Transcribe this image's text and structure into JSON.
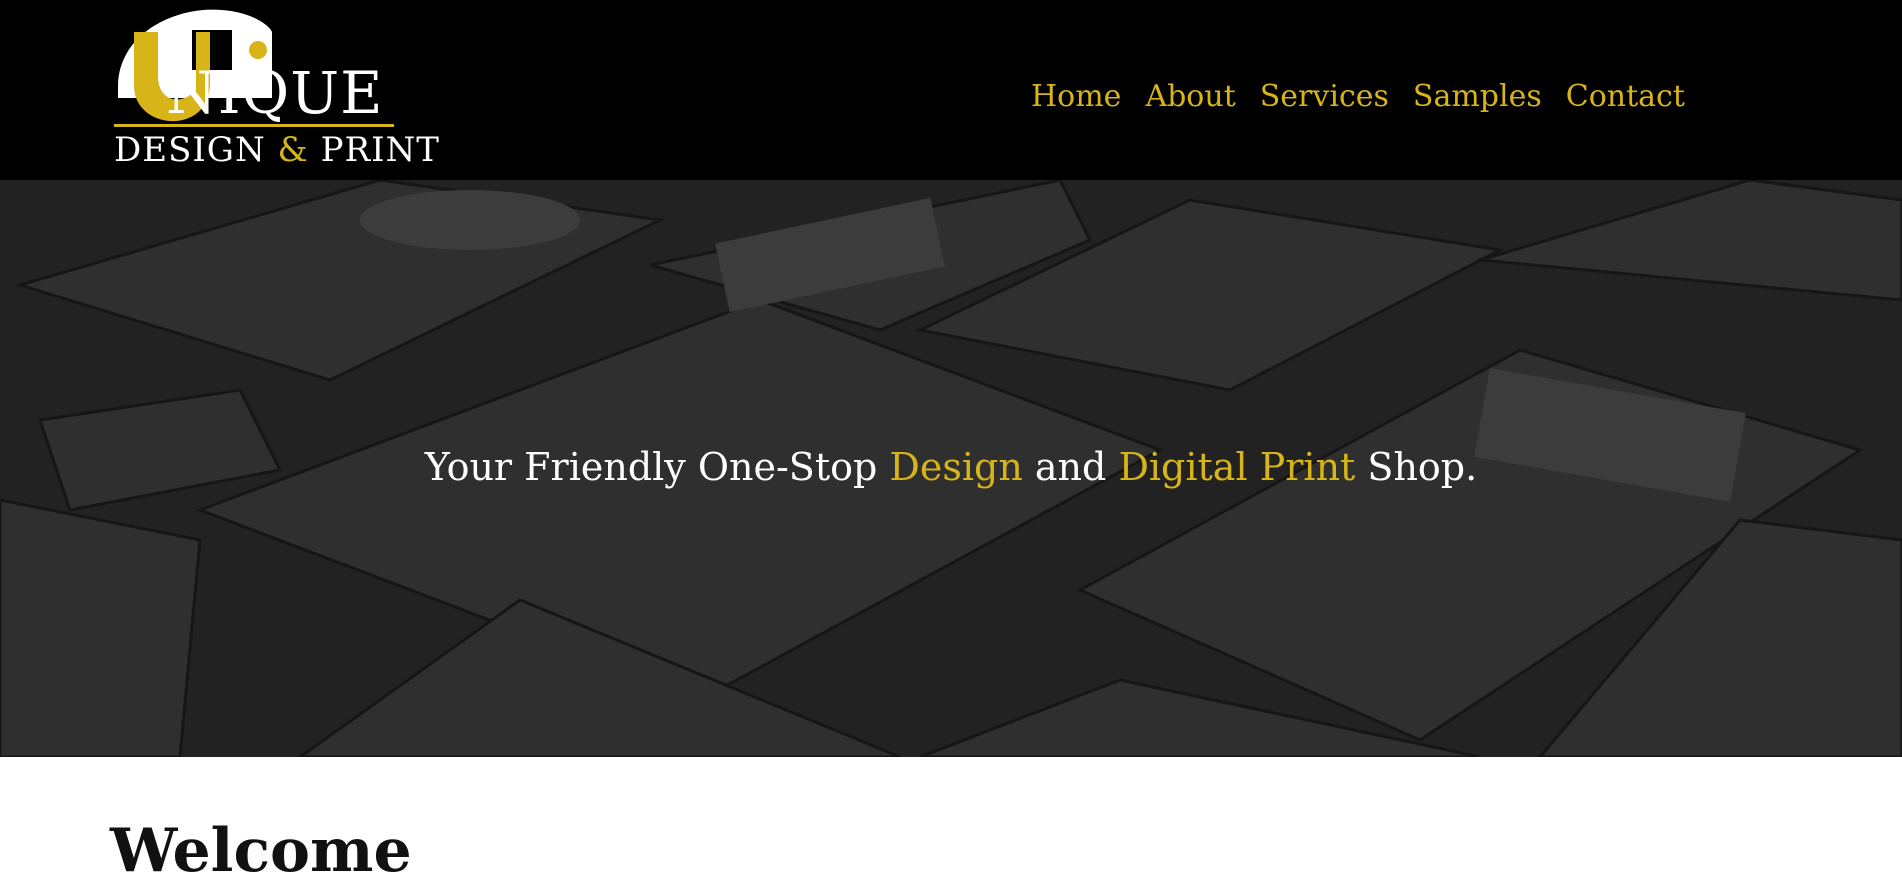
{
  "brand": {
    "line1": "NIQUE",
    "line2_a": "DESIGN ",
    "line2_amp": "&",
    "line2_b": " PRINT"
  },
  "nav": [
    "Home",
    "About",
    "Services",
    "Samples",
    "Contact"
  ],
  "hero": {
    "part1": "Your Friendly One-Stop ",
    "accent1": "Design",
    "part2": " and ",
    "accent2": "Digital Print",
    "part3": " Shop."
  },
  "main": {
    "heading": "Welcome"
  },
  "colors": {
    "accent": "#d7b417",
    "header_bg": "#000000",
    "hero_overlay": "#2b2b2b",
    "text_on_dark": "#ffffff"
  }
}
